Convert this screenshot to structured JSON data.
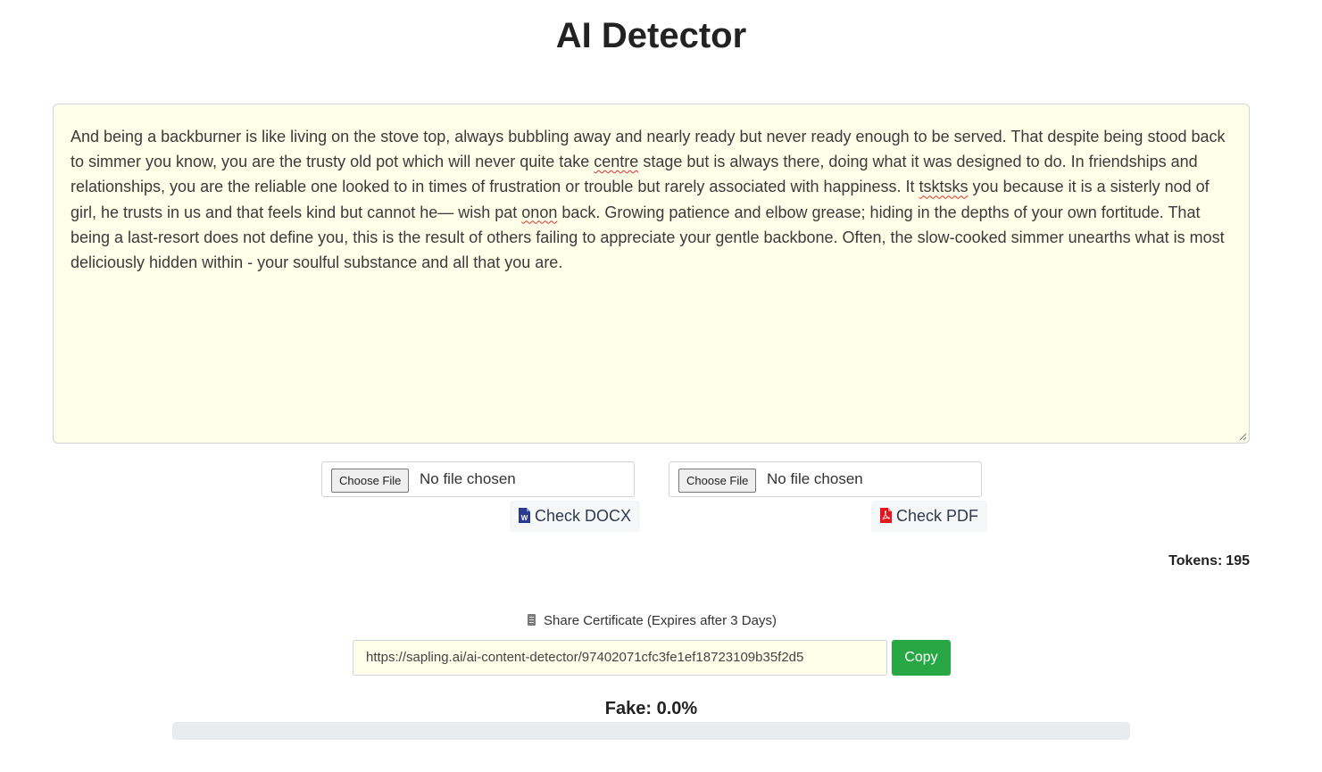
{
  "header": {
    "title": "AI Detector"
  },
  "editor": {
    "segments": [
      {
        "text": "And being a backburner is like living on the stove top, always bubbling away and nearly ready but never ready enough to be served. That despite being stood back to simmer you know, you are the trusty old pot which will never quite take ",
        "spell": false
      },
      {
        "text": "centre",
        "spell": true
      },
      {
        "text": " stage but is always there, doing what it was designed to do. In friendships and relationships, you are the reliable one looked to in times of frustration or trouble but rarely associated with happiness. It ",
        "spell": false
      },
      {
        "text": "tsktsks",
        "spell": true
      },
      {
        "text": " you because it is a sisterly nod of girl, he trusts in us and that feels kind but cannot he— wish pat ",
        "spell": false
      },
      {
        "text": "onon",
        "spell": true
      },
      {
        "text": " back. Growing patience and elbow grease; hiding in the depths of your own fortitude. That being a last-resort does not define you, this is the result of others failing to appreciate your gentle backbone. Often, the slow-cooked simmer unearths what is most deliciously hidden within - your soulful substance and all that you are.",
        "spell": false
      }
    ]
  },
  "uploads": {
    "docx": {
      "choose_label": "Choose File",
      "status": "No file chosen",
      "check_label": "Check DOCX",
      "icon": "word-icon",
      "icon_color": "#2b3990"
    },
    "pdf": {
      "choose_label": "Choose File",
      "status": "No file chosen",
      "check_label": "Check PDF",
      "icon": "pdf-icon",
      "icon_color": "#e8131b"
    }
  },
  "stats": {
    "tokens_label": "Tokens:",
    "tokens_value": "195"
  },
  "share": {
    "label": "Share Certificate (Expires after 3 Days)",
    "icon": "document-icon",
    "url": "https://sapling.ai/ai-content-detector/97402071cfc3fe1ef18723109b35f2d5",
    "copy_label": "Copy",
    "copy_color": "#28a745"
  },
  "result": {
    "fake_label": "Fake:",
    "fake_value": "0.0%",
    "fake_fraction": 0.0
  }
}
